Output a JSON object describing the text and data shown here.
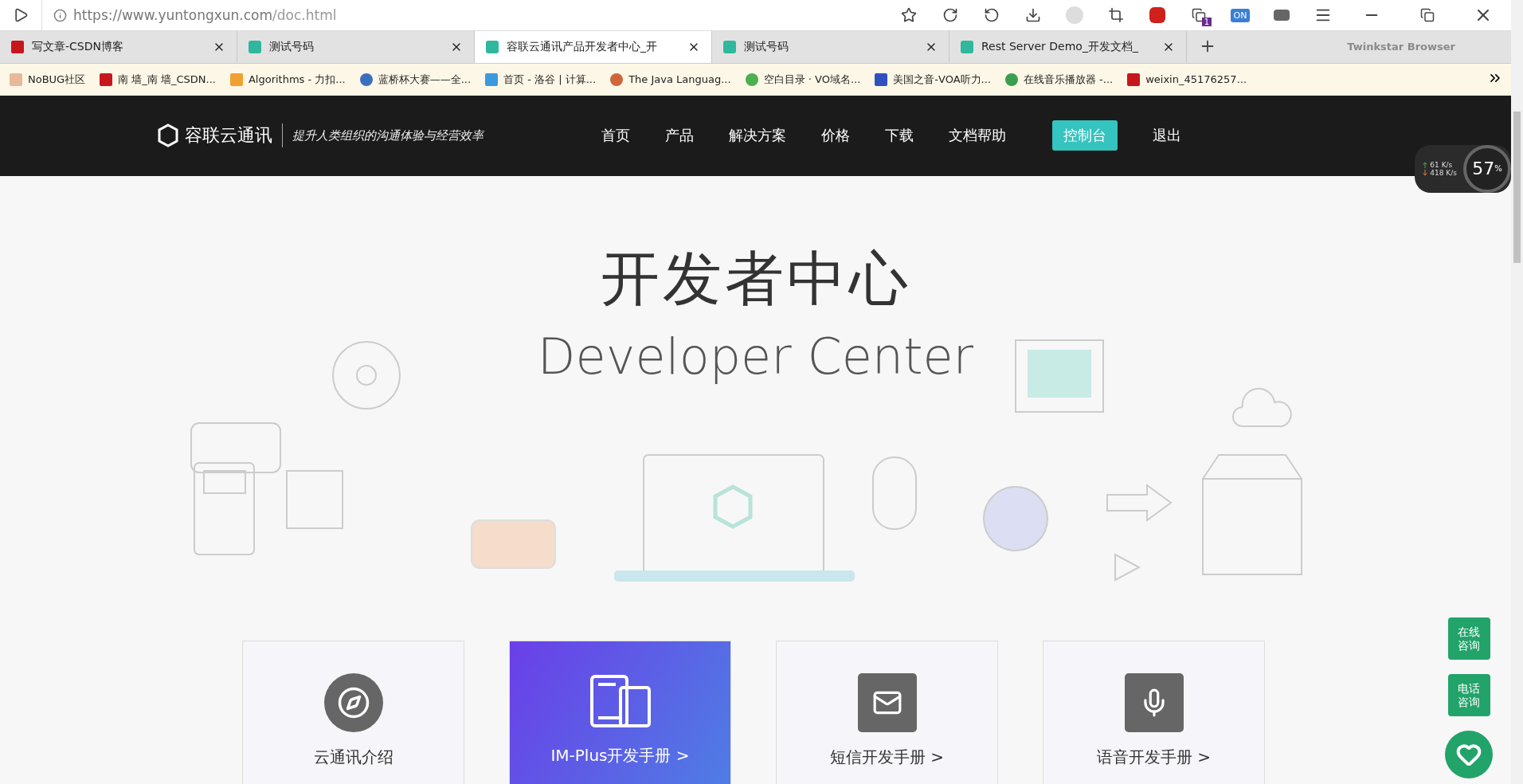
{
  "address_bar": {
    "url_host": "https://www.yuntongxun.com",
    "url_path": "/doc.html",
    "badge": "1",
    "toggle": "ON"
  },
  "tabs": [
    {
      "title": "写文章-CSDN博客",
      "selected": false
    },
    {
      "title": "测试号码",
      "selected": false
    },
    {
      "title": "容联云通讯产品开发者中心_开",
      "selected": true
    },
    {
      "title": "测试号码",
      "selected": false
    },
    {
      "title": "Rest Server Demo_开发文档_",
      "selected": false
    }
  ],
  "browser_name": "Twinkstar Browser",
  "bookmarks": [
    "NoBUG社区",
    "南 墙_南 墙_CSDN...",
    "Algorithms - 力扣...",
    "蓝桥杯大赛——全...",
    "首页 - 洛谷 | 计算...",
    "The Java Languag...",
    "空白目录 · VO域名...",
    "美国之音-VOA听力...",
    "在线音乐播放器 -...",
    "weixin_45176257..."
  ],
  "site_nav": {
    "logo": "容联云通讯",
    "slogan": "提升人类组织的沟通体验与经营效率",
    "items": [
      "首页",
      "产品",
      "解决方案",
      "价格",
      "下载",
      "文档帮助"
    ],
    "console": "控制台",
    "logout": "退出"
  },
  "speed_widget": {
    "upload": "61  K/s",
    "download": "418 K/s",
    "percent": "57",
    "unit": "%"
  },
  "hero": {
    "title": "开发者中心",
    "subtitle": "Developer Center"
  },
  "cards": [
    {
      "label": "云通讯介绍",
      "kind": "compass",
      "highlight": false
    },
    {
      "label": "IM-Plus开发手册 >",
      "kind": "im",
      "highlight": true
    },
    {
      "label": "短信开发手册 >",
      "kind": "sms",
      "highlight": false
    },
    {
      "label": "语音开发手册 >",
      "kind": "voice",
      "highlight": false
    }
  ],
  "float_buttons": [
    [
      "在线",
      "咨询"
    ],
    [
      "电话",
      "咨询"
    ]
  ]
}
